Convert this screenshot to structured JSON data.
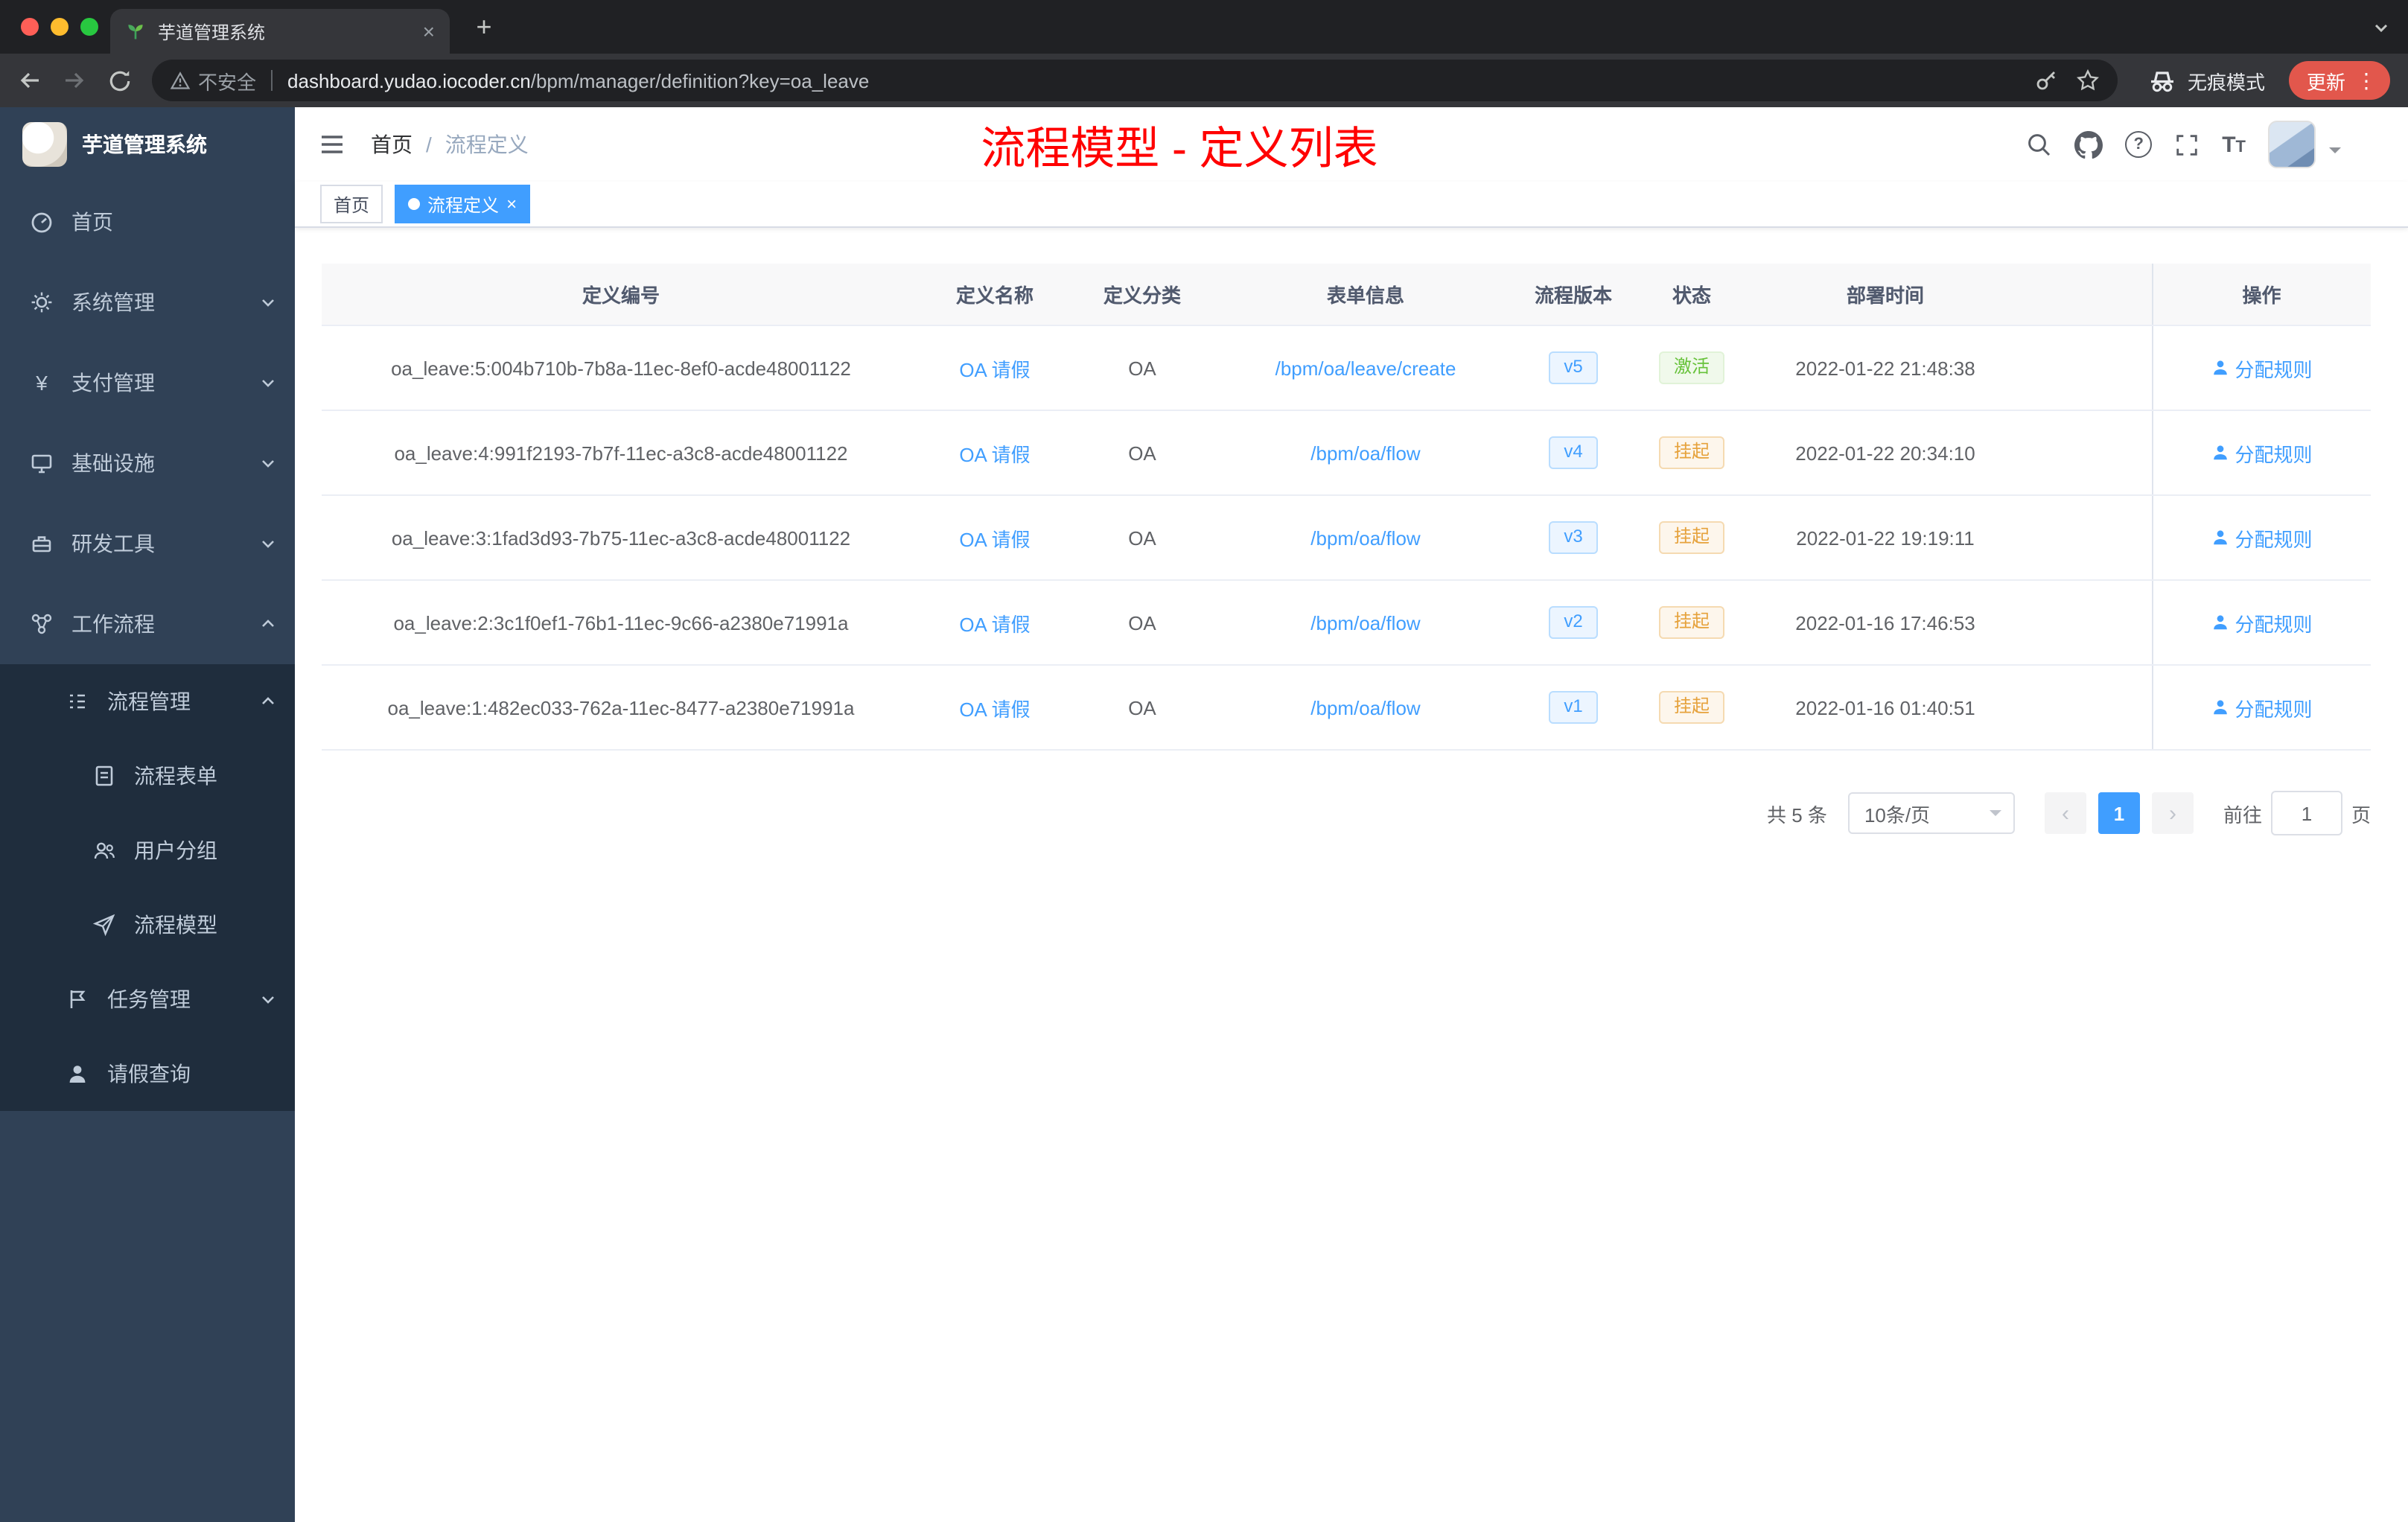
{
  "browser": {
    "tab_title": "芋道管理系统",
    "security_label": "不安全",
    "url_host": "dashboard.yudao.iocoder.cn",
    "url_path": "/bpm/manager/definition?key=oa_leave",
    "incognito_label": "无痕模式",
    "update_label": "更新"
  },
  "sidebar": {
    "logo_title": "芋道管理系统",
    "items": [
      {
        "label": "首页"
      },
      {
        "label": "系统管理"
      },
      {
        "label": "支付管理"
      },
      {
        "label": "基础设施"
      },
      {
        "label": "研发工具"
      },
      {
        "label": "工作流程"
      }
    ],
    "sub": [
      {
        "label": "流程管理"
      },
      {
        "label": "流程表单"
      },
      {
        "label": "用户分组"
      },
      {
        "label": "流程模型"
      },
      {
        "label": "任务管理"
      },
      {
        "label": "请假查询"
      }
    ]
  },
  "navbar": {
    "breadcrumb": {
      "home": "首页",
      "sep": "/",
      "current": "流程定义"
    },
    "annotation": "流程模型 - 定义列表"
  },
  "tags": {
    "home": "首页",
    "active": "流程定义",
    "close": "×"
  },
  "table": {
    "headers": [
      "定义编号",
      "定义名称",
      "定义分类",
      "表单信息",
      "流程版本",
      "状态",
      "部署时间",
      "操作"
    ],
    "action_label": "分配规则",
    "rows": [
      {
        "id": "oa_leave:5:004b710b-7b8a-11ec-8ef0-acde48001122",
        "name": "OA 请假",
        "category": "OA",
        "form": "/bpm/oa/leave/create",
        "version": "v5",
        "status": "激活",
        "time": "2022-01-22 21:48:38"
      },
      {
        "id": "oa_leave:4:991f2193-7b7f-11ec-a3c8-acde48001122",
        "name": "OA 请假",
        "category": "OA",
        "form": "/bpm/oa/flow",
        "version": "v4",
        "status": "挂起",
        "time": "2022-01-22 20:34:10"
      },
      {
        "id": "oa_leave:3:1fad3d93-7b75-11ec-a3c8-acde48001122",
        "name": "OA 请假",
        "category": "OA",
        "form": "/bpm/oa/flow",
        "version": "v3",
        "status": "挂起",
        "time": "2022-01-22 19:19:11"
      },
      {
        "id": "oa_leave:2:3c1f0ef1-76b1-11ec-9c66-a2380e71991a",
        "name": "OA 请假",
        "category": "OA",
        "form": "/bpm/oa/flow",
        "version": "v2",
        "status": "挂起",
        "time": "2022-01-16 17:46:53"
      },
      {
        "id": "oa_leave:1:482ec033-762a-11ec-8477-a2380e71991a",
        "name": "OA 请假",
        "category": "OA",
        "form": "/bpm/oa/flow",
        "version": "v1",
        "status": "挂起",
        "time": "2022-01-16 01:40:51"
      }
    ]
  },
  "pagination": {
    "total": "共 5 条",
    "page_size": "10条/页",
    "page": "1",
    "goto_label": "前往",
    "goto_value": "1",
    "unit_label": "页"
  },
  "colors": {
    "accent": "#409eff",
    "success": "#67c23a",
    "warning": "#e6a23c",
    "annotation": "#ff0000",
    "sidebar_bg": "#304156",
    "submenu_bg": "#1f2d3d"
  }
}
